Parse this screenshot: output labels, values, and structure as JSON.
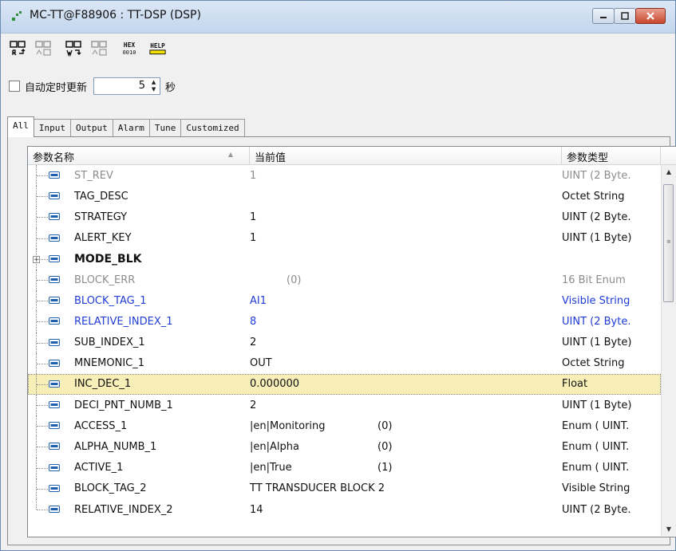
{
  "window": {
    "title": "MC-TT@F88906 : TT-DSP (DSP)"
  },
  "toolbar": {
    "buttons": [
      {
        "name": "read-button"
      },
      {
        "name": "read-all-button"
      },
      {
        "name": "write-button"
      },
      {
        "name": "write-all-button"
      },
      {
        "name": "hex-button",
        "label": "HEX\n0010"
      },
      {
        "name": "help-button",
        "label": "HELP"
      }
    ]
  },
  "auto_update": {
    "label": "自动定时更新",
    "interval": "5",
    "unit": "秒",
    "checked": false
  },
  "tabs": [
    "All",
    "Input",
    "Output",
    "Alarm",
    "Tune",
    "Customized"
  ],
  "active_tab": "All",
  "grid": {
    "columns": [
      "参数名称",
      "当前值",
      "参数类型"
    ],
    "rows": [
      {
        "name": "ST_REV",
        "value": "1",
        "code": "",
        "type": "UINT (2 Byte.",
        "color": "gray"
      },
      {
        "name": "TAG_DESC",
        "value": "",
        "code": "",
        "type": "Octet String",
        "color": "black"
      },
      {
        "name": "STRATEGY",
        "value": "1",
        "code": "",
        "type": "UINT (2 Byte.",
        "color": "black"
      },
      {
        "name": "ALERT_KEY",
        "value": "1",
        "code": "",
        "type": "UINT (1 Byte)",
        "color": "black"
      },
      {
        "name": "MODE_BLK",
        "value": "",
        "code": "",
        "type": "",
        "color": "black",
        "bold": true,
        "expandable": true
      },
      {
        "name": "BLOCK_ERR",
        "value": "",
        "code": "(0)",
        "type": "16 Bit Enum",
        "color": "gray"
      },
      {
        "name": "BLOCK_TAG_1",
        "value": "AI1",
        "code": "",
        "type": "Visible String",
        "color": "blue"
      },
      {
        "name": "RELATIVE_INDEX_1",
        "value": "8",
        "code": "",
        "type": "UINT (2 Byte.",
        "color": "blue"
      },
      {
        "name": "SUB_INDEX_1",
        "value": "2",
        "code": "",
        "type": "UINT (1 Byte)",
        "color": "black"
      },
      {
        "name": "MNEMONIC_1",
        "value": "OUT",
        "code": "",
        "type": "Octet String",
        "color": "black"
      },
      {
        "name": "INC_DEC_1",
        "value": "0.000000",
        "code": "",
        "type": "Float",
        "color": "black",
        "selected": true
      },
      {
        "name": "DECI_PNT_NUMB_1",
        "value": "2",
        "code": "",
        "type": "UINT (1 Byte)",
        "color": "black"
      },
      {
        "name": "ACCESS_1",
        "value": "|en|Monitoring",
        "code": "(0)",
        "type": "Enum ( UINT.",
        "color": "black"
      },
      {
        "name": "ALPHA_NUMB_1",
        "value": "|en|Alpha",
        "code": "(0)",
        "type": "Enum ( UINT.",
        "color": "black"
      },
      {
        "name": "ACTIVE_1",
        "value": "|en|True",
        "code": "(1)",
        "type": "Enum ( UINT.",
        "color": "black"
      },
      {
        "name": "BLOCK_TAG_2",
        "value": "TT TRANSDUCER BLOCK 2",
        "code": "",
        "type": "Visible String",
        "color": "black"
      },
      {
        "name": "RELATIVE_INDEX_2",
        "value": "14",
        "code": "",
        "type": "UINT (2 Byte.",
        "color": "black"
      }
    ]
  },
  "colors": {
    "gray": "#8c8c8c",
    "blue": "#1f3cd6",
    "selected_row": "#f8eeb8"
  }
}
